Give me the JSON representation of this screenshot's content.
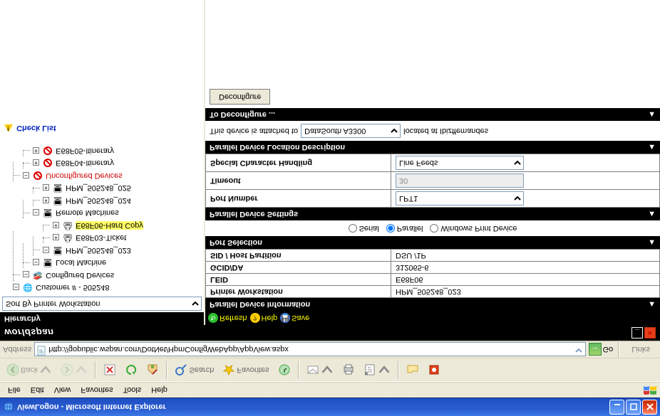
{
  "window": {
    "title": "ViewLogon - Microsoft Internet Explorer"
  },
  "menu": {
    "file": "File",
    "edit": "Edit",
    "view": "View",
    "favorites": "Favorites",
    "tools": "Tools",
    "help": "Help"
  },
  "ietb": {
    "back": "Back",
    "search": "Search",
    "favorites": "Favorites"
  },
  "address": {
    "label": "Address",
    "value": "http://gopublic.wspan.com/DotNet/HpmConfigWebApp/AppView.aspx",
    "go": "Go",
    "links": "Links"
  },
  "brand": "worldspan",
  "sidebar": {
    "header": "Hierarchy",
    "sort": "Sort By Printer Workstation",
    "tree": {
      "customer": "Customer # - 505248",
      "configured": "Configured Devices",
      "local": "Local Machine",
      "hpm023": "HPM_505248_023",
      "ticket": "E68F03-Ticket",
      "hardcopy": "E68F06-Hard Copy",
      "remote": "Remote Machines",
      "hpm024": "HPM_505248_024",
      "hpm025": "HPM_505248_025",
      "unconf": "Unconfigured Devices",
      "e68f04": "E68F04-Itinerary",
      "e68f05": "E68F05-Itinerary"
    },
    "checklist": "Check List"
  },
  "toolbar2": {
    "refresh": "Refresh",
    "help": "Help",
    "save": "Save"
  },
  "panel_info": {
    "title": "Parallel Device Information",
    "rows": [
      {
        "k": "Printer Workstation",
        "v": "HPM_505248_023"
      },
      {
        "k": "LEID",
        "v": "E68F06"
      },
      {
        "k": "GCID/DA",
        "v": "312065-6"
      },
      {
        "k": "SID / Host Partition",
        "v": "DSU /1P"
      }
    ]
  },
  "panel_port": {
    "title": "Port Selection",
    "serial": "Serial",
    "parallel": "Parallel",
    "wpd": "Windows Print Device"
  },
  "panel_set": {
    "title": "Parallel Device Settings",
    "port_k": "Port Number",
    "port_v": "LPT1",
    "timeout_k": "Timeout",
    "timeout_v": "30",
    "sch_k": "Special Character Handling",
    "sch_v": "Line Feeds"
  },
  "panel_loc": {
    "title": "Parallel Device Location Description",
    "t1": "This device is attached to",
    "dev": "DataSouth A3300",
    "t2": "located at Ibizffemandes"
  },
  "panel_decfg": {
    "title": "To Deconfigure ...",
    "btn": "Deconfigure"
  }
}
